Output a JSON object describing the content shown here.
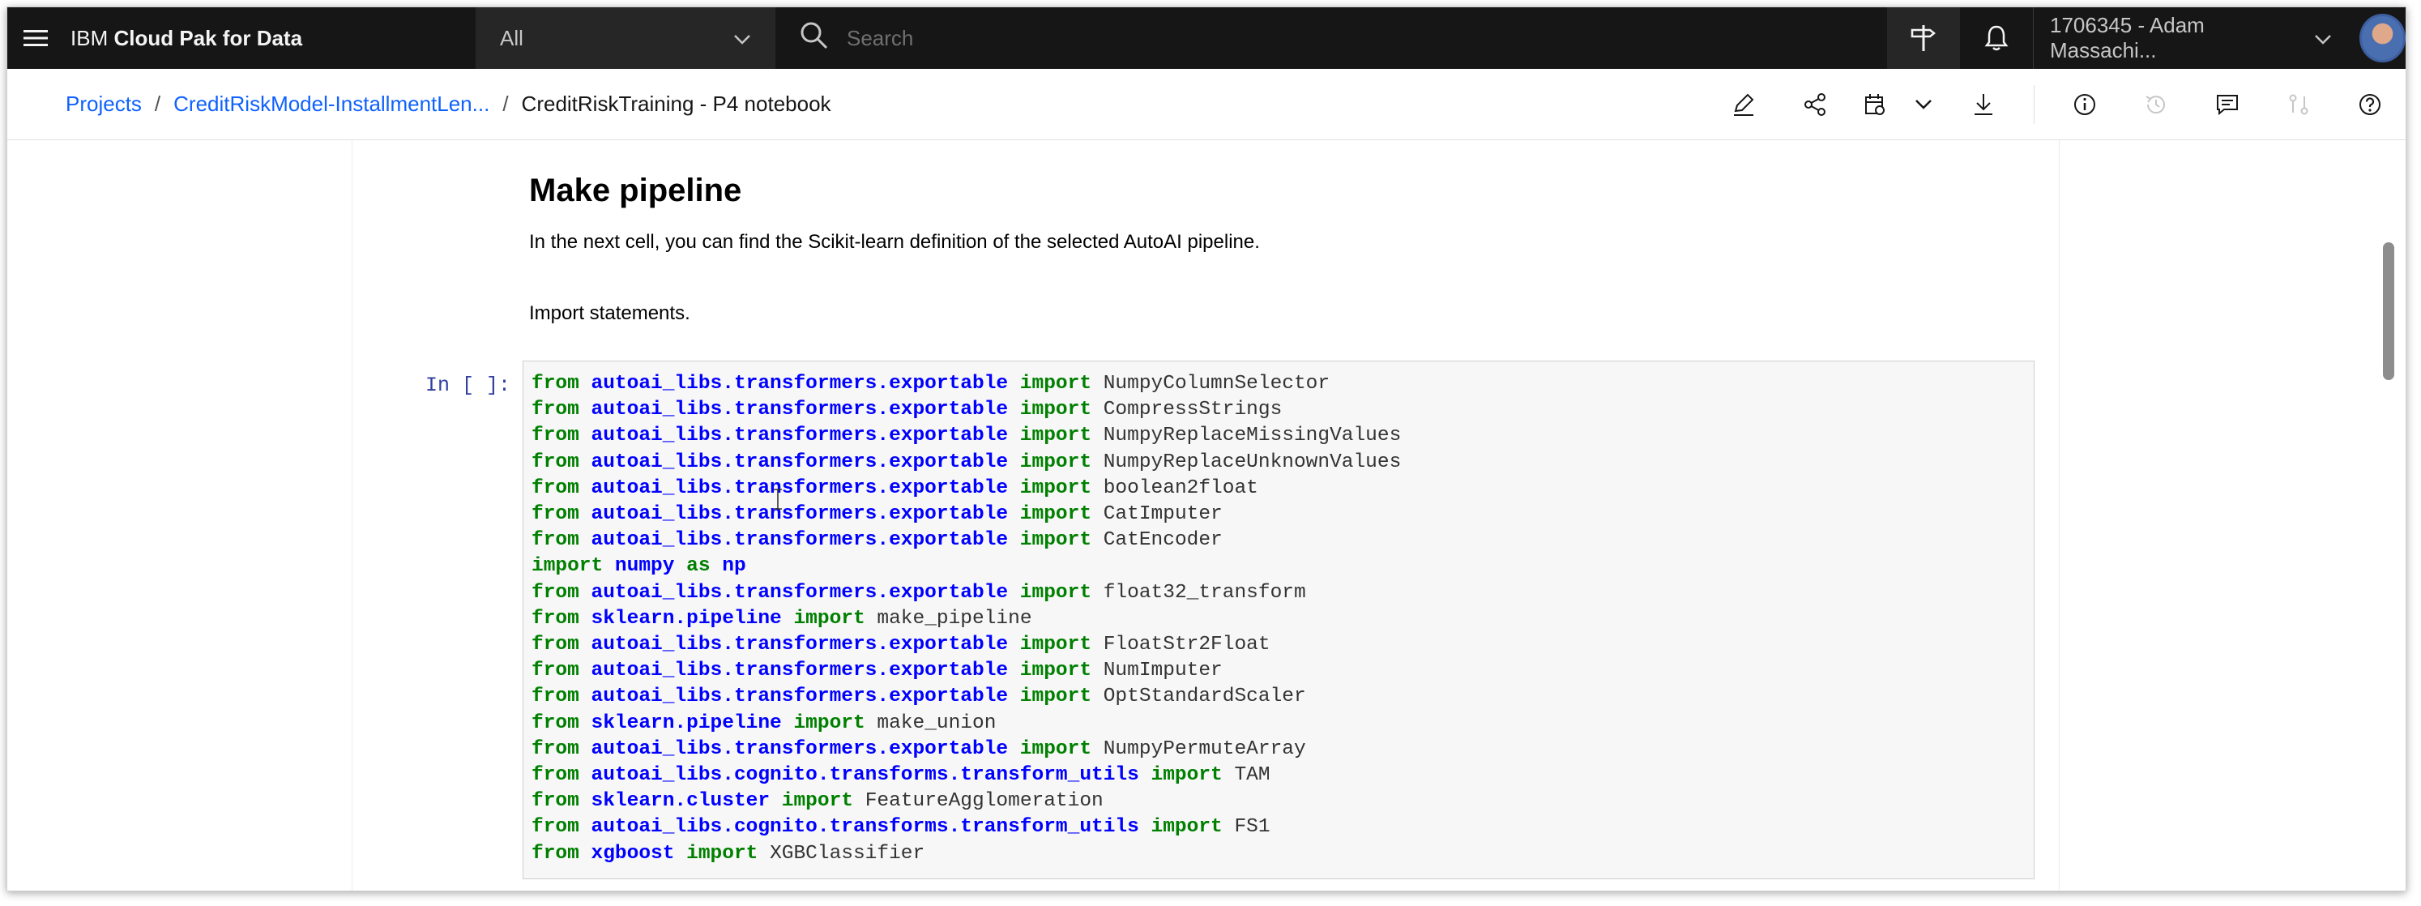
{
  "header": {
    "product_prefix": "IBM ",
    "product_name": "Cloud Pak for Data",
    "scope_label": "All",
    "search_placeholder": "Search",
    "account_label": "1706345 - Adam Massachi..."
  },
  "breadcrumb": {
    "items": [
      "Projects",
      "CreditRiskModel-InstallmentLen..."
    ],
    "separator": "/",
    "current": "CreditRiskTraining - P4 notebook"
  },
  "toolbar": {
    "icons": [
      "edit-icon",
      "share-icon",
      "schedule-icon",
      "chevron-down-icon",
      "download-icon",
      "info-icon",
      "history-icon",
      "comment-icon",
      "compare-icon",
      "help-icon"
    ]
  },
  "notebook": {
    "heading": "Make pipeline",
    "paragraph1": "In the next cell, you can find the Scikit-learn definition of the selected AutoAI pipeline.",
    "paragraph2": "Import statements.",
    "cell_prompt": "In [ ]:",
    "code_lines": [
      [
        {
          "t": "from ",
          "c": "kw"
        },
        {
          "t": "autoai_libs.transformers.exportable",
          "c": "mod"
        },
        {
          "t": " import ",
          "c": "kw"
        },
        {
          "t": "NumpyColumnSelector",
          "c": "ident"
        }
      ],
      [
        {
          "t": "from ",
          "c": "kw"
        },
        {
          "t": "autoai_libs.transformers.exportable",
          "c": "mod"
        },
        {
          "t": " import ",
          "c": "kw"
        },
        {
          "t": "CompressStrings",
          "c": "ident"
        }
      ],
      [
        {
          "t": "from ",
          "c": "kw"
        },
        {
          "t": "autoai_libs.transformers.exportable",
          "c": "mod"
        },
        {
          "t": " import ",
          "c": "kw"
        },
        {
          "t": "NumpyReplaceMissingValues",
          "c": "ident"
        }
      ],
      [
        {
          "t": "from ",
          "c": "kw"
        },
        {
          "t": "autoai_libs.transformers.exportable",
          "c": "mod"
        },
        {
          "t": " import ",
          "c": "kw"
        },
        {
          "t": "NumpyReplaceUnknownValues",
          "c": "ident"
        }
      ],
      [
        {
          "t": "from ",
          "c": "kw"
        },
        {
          "t": "autoai_libs.transformers.exportable",
          "c": "mod"
        },
        {
          "t": " import ",
          "c": "kw"
        },
        {
          "t": "boolean2float",
          "c": "ident"
        }
      ],
      [
        {
          "t": "from ",
          "c": "kw"
        },
        {
          "t": "autoai_libs.transformers.exportable",
          "c": "mod"
        },
        {
          "t": " import ",
          "c": "kw"
        },
        {
          "t": "CatImputer",
          "c": "ident"
        }
      ],
      [
        {
          "t": "from ",
          "c": "kw"
        },
        {
          "t": "autoai_libs.transformers.exportable",
          "c": "mod"
        },
        {
          "t": " import ",
          "c": "kw"
        },
        {
          "t": "CatEncoder",
          "c": "ident"
        }
      ],
      [
        {
          "t": "import ",
          "c": "kw"
        },
        {
          "t": "numpy",
          "c": "mod"
        },
        {
          "t": " as ",
          "c": "kw"
        },
        {
          "t": "np",
          "c": "mod"
        }
      ],
      [
        {
          "t": "from ",
          "c": "kw"
        },
        {
          "t": "autoai_libs.transformers.exportable",
          "c": "mod"
        },
        {
          "t": " import ",
          "c": "kw"
        },
        {
          "t": "float32_transform",
          "c": "ident"
        }
      ],
      [
        {
          "t": "from ",
          "c": "kw"
        },
        {
          "t": "sklearn.pipeline",
          "c": "mod"
        },
        {
          "t": " import ",
          "c": "kw"
        },
        {
          "t": "make_pipeline",
          "c": "ident"
        }
      ],
      [
        {
          "t": "from ",
          "c": "kw"
        },
        {
          "t": "autoai_libs.transformers.exportable",
          "c": "mod"
        },
        {
          "t": " import ",
          "c": "kw"
        },
        {
          "t": "FloatStr2Float",
          "c": "ident"
        }
      ],
      [
        {
          "t": "from ",
          "c": "kw"
        },
        {
          "t": "autoai_libs.transformers.exportable",
          "c": "mod"
        },
        {
          "t": " import ",
          "c": "kw"
        },
        {
          "t": "NumImputer",
          "c": "ident"
        }
      ],
      [
        {
          "t": "from ",
          "c": "kw"
        },
        {
          "t": "autoai_libs.transformers.exportable",
          "c": "mod"
        },
        {
          "t": " import ",
          "c": "kw"
        },
        {
          "t": "OptStandardScaler",
          "c": "ident"
        }
      ],
      [
        {
          "t": "from ",
          "c": "kw"
        },
        {
          "t": "sklearn.pipeline",
          "c": "mod"
        },
        {
          "t": " import ",
          "c": "kw"
        },
        {
          "t": "make_union",
          "c": "ident"
        }
      ],
      [
        {
          "t": "from ",
          "c": "kw"
        },
        {
          "t": "autoai_libs.transformers.exportable",
          "c": "mod"
        },
        {
          "t": " import ",
          "c": "kw"
        },
        {
          "t": "NumpyPermuteArray",
          "c": "ident"
        }
      ],
      [
        {
          "t": "from ",
          "c": "kw"
        },
        {
          "t": "autoai_libs.cognito.transforms.transform_utils",
          "c": "mod"
        },
        {
          "t": " import ",
          "c": "kw"
        },
        {
          "t": "TAM",
          "c": "ident"
        }
      ],
      [
        {
          "t": "from ",
          "c": "kw"
        },
        {
          "t": "sklearn.cluster",
          "c": "mod"
        },
        {
          "t": " import ",
          "c": "kw"
        },
        {
          "t": "FeatureAgglomeration",
          "c": "ident"
        }
      ],
      [
        {
          "t": "from ",
          "c": "kw"
        },
        {
          "t": "autoai_libs.cognito.transforms.transform_utils",
          "c": "mod"
        },
        {
          "t": " import ",
          "c": "kw"
        },
        {
          "t": "FS1",
          "c": "ident"
        }
      ],
      [
        {
          "t": "from ",
          "c": "kw"
        },
        {
          "t": "xgboost",
          "c": "mod"
        },
        {
          "t": " import ",
          "c": "kw"
        },
        {
          "t": "XGBClassifier",
          "c": "ident"
        }
      ]
    ]
  },
  "colors": {
    "header_bg": "#161616",
    "link": "#0f62fe",
    "keyword": "#008000",
    "module": "#0000ff"
  }
}
